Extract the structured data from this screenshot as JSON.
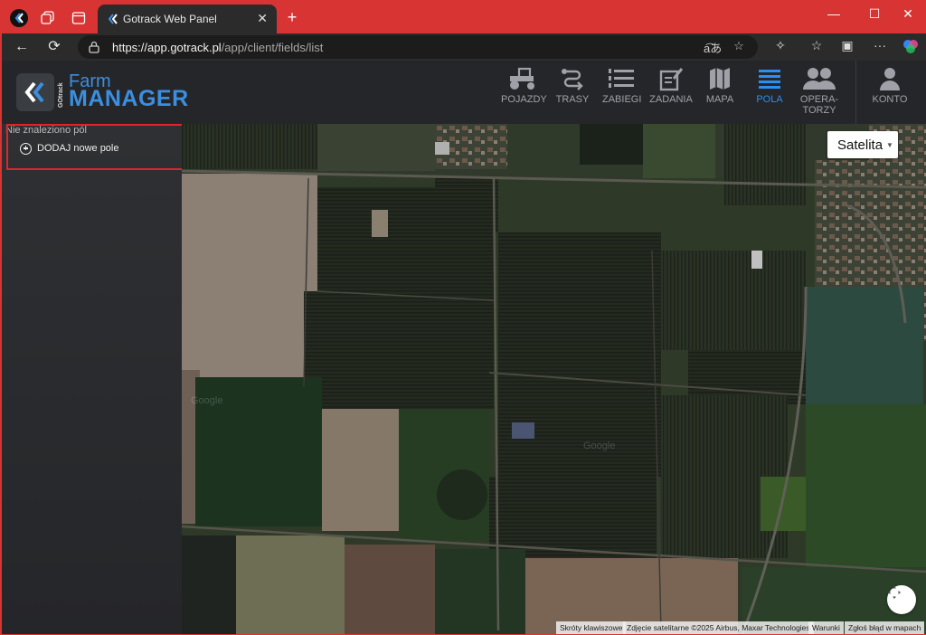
{
  "browser": {
    "tab_title": "Gotrack Web Panel",
    "url_host": "https://app.gotrack.pl",
    "url_path": "/app/client/fields/list",
    "accent_color": "#d83434"
  },
  "app": {
    "logo": {
      "brand_small": "GOtrack",
      "farm": "Farm",
      "manager": "MANAGER",
      "color": "#3a8fe0"
    },
    "nav": [
      {
        "label": "POJAZDY",
        "icon": "tractor-icon"
      },
      {
        "label": "TRASY",
        "icon": "route-icon"
      },
      {
        "label": "ZABIEGI",
        "icon": "list-icon"
      },
      {
        "label": "ZADANIA",
        "icon": "task-icon"
      },
      {
        "label": "MAPA",
        "icon": "map-icon"
      },
      {
        "label": "POLA",
        "icon": "fields-icon",
        "active": true
      },
      {
        "label": "OPERA-",
        "label2": "TORZY",
        "icon": "operators-icon"
      },
      {
        "label": "KONTO",
        "icon": "account-icon"
      }
    ],
    "active_color": "#2c8ef0"
  },
  "sidebar": {
    "empty_text": "Nie znaleziono pól",
    "add_button": "DODAJ nowe pole"
  },
  "map": {
    "type_button": "Satelita",
    "watermark": "Google",
    "attribution": [
      "Skróty klawiszowe",
      "Zdjęcie satelitarne ©2025 Airbus, Maxar Technologies",
      "Warunki",
      "Zgłoś błąd w mapach"
    ]
  }
}
